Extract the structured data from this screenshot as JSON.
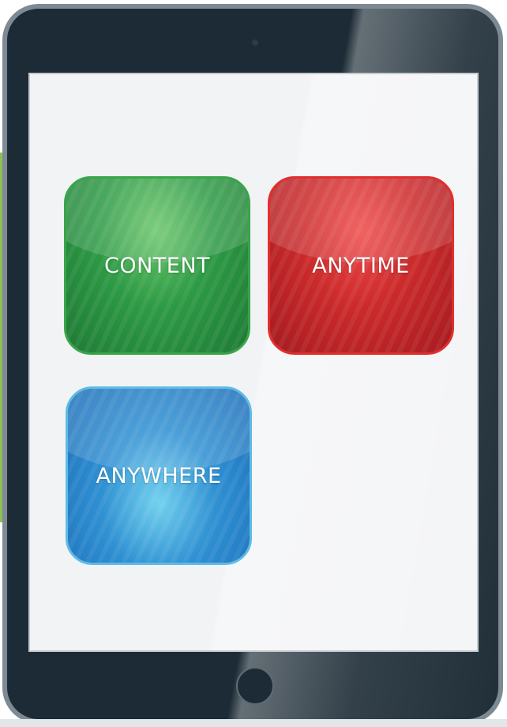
{
  "tiles": {
    "content": {
      "label": "CONTENT",
      "color": "#2d9a45"
    },
    "anytime": {
      "label": "ANYTIME",
      "color": "#cb2a2b"
    },
    "anywhere": {
      "label": "ANYWHERE",
      "color": "#2f90d2"
    }
  },
  "colors": {
    "tablet_body": "#1c2b35",
    "tablet_border": "#7d8a93",
    "screen_background": "#f2f3f5",
    "side_bar": "#8cc152"
  },
  "icons": {
    "camera": "camera-icon",
    "home_button": "home-button"
  }
}
